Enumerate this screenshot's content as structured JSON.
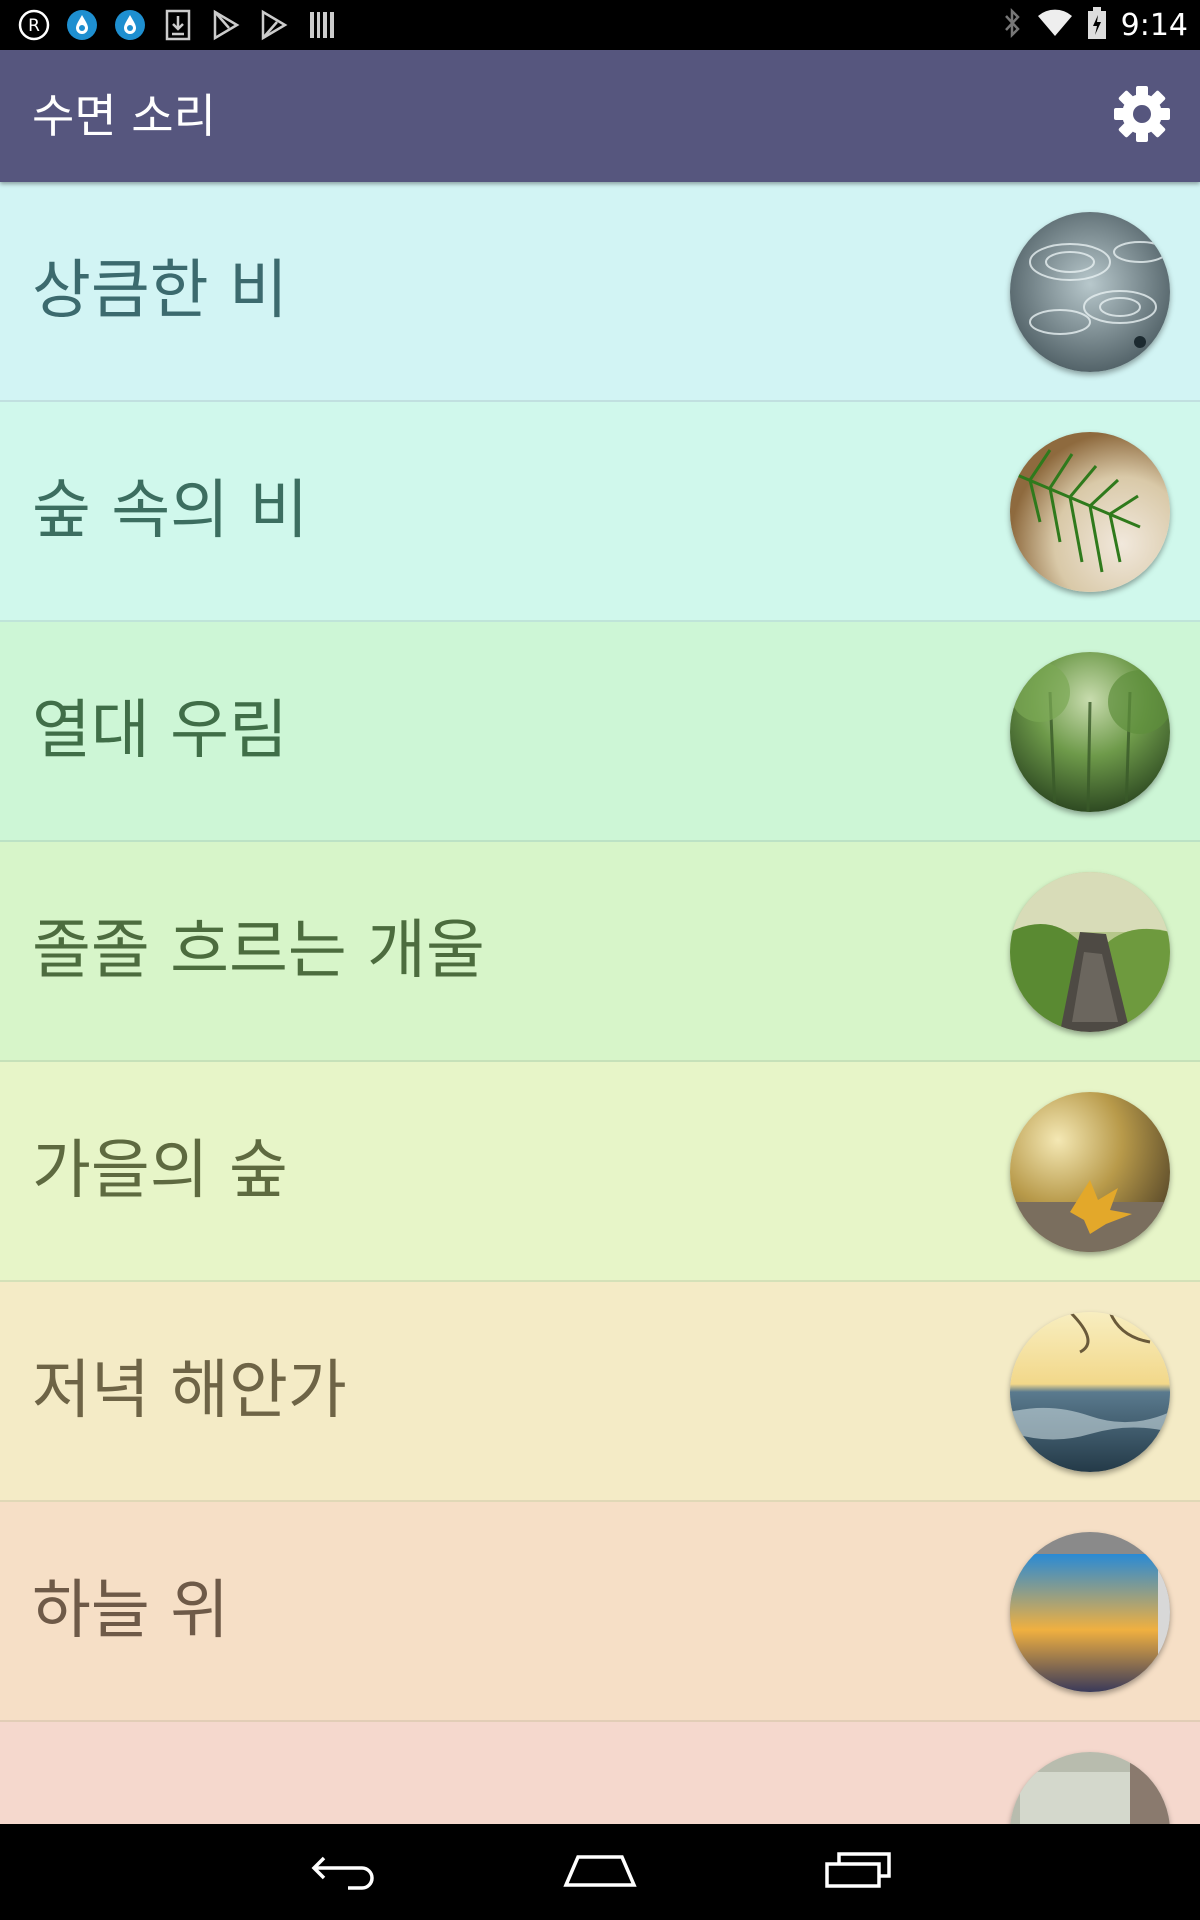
{
  "status_bar": {
    "time": "9:14",
    "left_icons": [
      "registered-icon",
      "water-drop-icon",
      "water-drop-icon",
      "download-icon",
      "play-store-icon",
      "play-store-icon",
      "barcode-icon"
    ],
    "right_icons": [
      "bluetooth-icon",
      "wifi-icon",
      "battery-icon"
    ]
  },
  "app_bar": {
    "title": "수면 소리",
    "settings_icon": "gear-icon",
    "color": "#56567e"
  },
  "sounds": [
    {
      "label": "상큼한 비",
      "bg": "#d2f4f4",
      "text_color": "#3c6a6e",
      "image": "rain-drops"
    },
    {
      "label": "숲 속의 비",
      "bg": "#d0f8ec",
      "text_color": "#3c6e60",
      "image": "pine-branch"
    },
    {
      "label": "열대 우림",
      "bg": "#cdf6d6",
      "text_color": "#406e48",
      "image": "rainforest"
    },
    {
      "label": "졸졸 흐르는 개울",
      "bg": "#d7f5c9",
      "text_color": "#4c6c3e",
      "image": "brook"
    },
    {
      "label": "가을의 숲",
      "bg": "#e7f5c8",
      "text_color": "#5e6a40",
      "image": "autumn-leaf"
    },
    {
      "label": "저녁 해안가",
      "bg": "#f4ebc6",
      "text_color": "#6e6446",
      "image": "sea-sunset"
    },
    {
      "label": "하늘 위",
      "bg": "#f6dfc6",
      "text_color": "#6e5a48",
      "image": "airplane-window"
    },
    {
      "label": "",
      "bg": "#f5d8cd",
      "text_color": "#6e5048",
      "image": "window-rain"
    }
  ],
  "nav_bar": {
    "icons": [
      "back-icon",
      "home-icon",
      "recent-apps-icon"
    ]
  }
}
